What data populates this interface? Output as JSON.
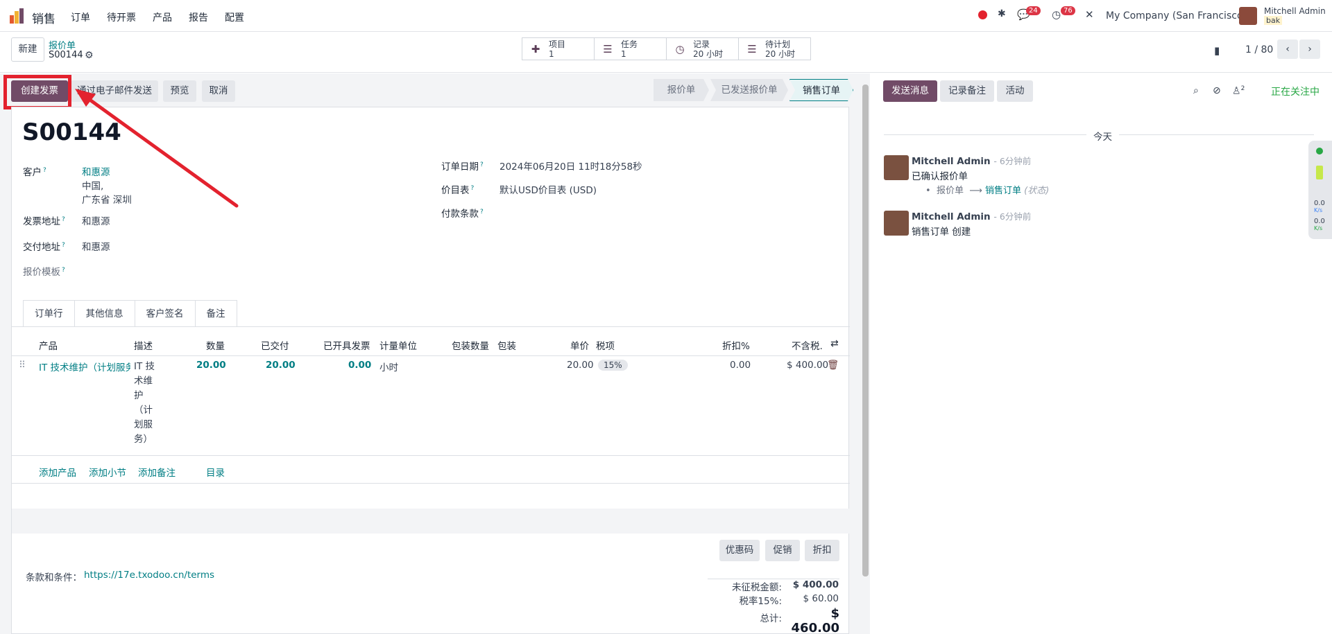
{
  "app": {
    "name": "销售",
    "menu": [
      "订单",
      "待开票",
      "产品",
      "报告",
      "配置"
    ]
  },
  "systray": {
    "chat_count": "24",
    "activity_count": "76",
    "company": "My Company (San Francisco)",
    "user_name": "Mitchell Admin",
    "user_db": "bak"
  },
  "control_panel": {
    "new_label": "新建",
    "breadcrumb_parent": "报价单",
    "breadcrumb_current": "S00144",
    "smart_buttons": [
      {
        "label": "项目",
        "value": "1"
      },
      {
        "label": "任务",
        "value": "1"
      },
      {
        "label": "记录",
        "value": "20 小时"
      },
      {
        "label": "待计划",
        "value": "20 小时"
      }
    ],
    "pager": "1 / 80"
  },
  "actions": {
    "create_invoice": "创建发票",
    "send_email": "通过电子邮件发送",
    "preview": "预览",
    "cancel": "取消"
  },
  "statusbar": [
    "报价单",
    "已发送报价单",
    "销售订单"
  ],
  "form": {
    "name": "S00144",
    "customer_label": "客户",
    "customer_name": "和惠源",
    "customer_addr1": "中国,",
    "customer_addr2": "广东省 深圳",
    "invoice_addr_label": "发票地址",
    "invoice_addr": "和惠源",
    "delivery_addr_label": "交付地址",
    "delivery_addr": "和惠源",
    "template_label": "报价模板",
    "order_date_label": "订单日期",
    "order_date": "2024年06月20日 11时18分58秒",
    "pricelist_label": "价目表",
    "pricelist": "默认USD价目表 (USD)",
    "payment_terms_label": "付款条款"
  },
  "tabs": [
    "订单行",
    "其他信息",
    "客户签名",
    "备注"
  ],
  "lines": {
    "headers": [
      "产品",
      "描述",
      "数量",
      "已交付",
      "已开具发票",
      "计量单位",
      "包装数量",
      "包装",
      "单价",
      "税项",
      "折扣%",
      "不含税."
    ],
    "row": {
      "product": "IT 技术维护（计划服务",
      "desc": [
        "IT 技",
        "术维",
        "护",
        "（计",
        "划服",
        "务）"
      ],
      "qty": "20.00",
      "delivered": "20.00",
      "invoiced": "0.00",
      "uom": "小时",
      "price": "20.00",
      "tax": "15%",
      "discount": "0.00",
      "subtotal": "$ 400.00"
    },
    "add_product": "添加产品",
    "add_section": "添加小节",
    "add_note": "添加备注",
    "catalog": "目录"
  },
  "footer": {
    "coupon": "优惠码",
    "promo": "促销",
    "discount": "折扣",
    "terms_label": "条款和条件：",
    "terms_link": "https://17e.txodoo.cn/terms",
    "untaxed_label": "未征税金额:",
    "untaxed": "$ 400.00",
    "tax_label": "税率15%:",
    "tax": "$ 60.00",
    "total_label": "总计:",
    "total": "$ 460.00"
  },
  "chatter": {
    "send_message": "发送消息",
    "log_note": "记录备注",
    "activity": "活动",
    "followers_count": "2",
    "following": "正在关注中",
    "today": "今天",
    "messages": [
      {
        "author": "Mitchell Admin",
        "time": "- 6分钟前",
        "body": "已确认报价单",
        "track_from": "报价单",
        "track_to": "销售订单",
        "track_field": "(状态)"
      },
      {
        "author": "Mitchell Admin",
        "time": "- 6分钟前",
        "body": "销售订单 创建"
      }
    ]
  },
  "side_widget": {
    "up": "0.0",
    "down": "0.0",
    "unit": "K/s"
  }
}
